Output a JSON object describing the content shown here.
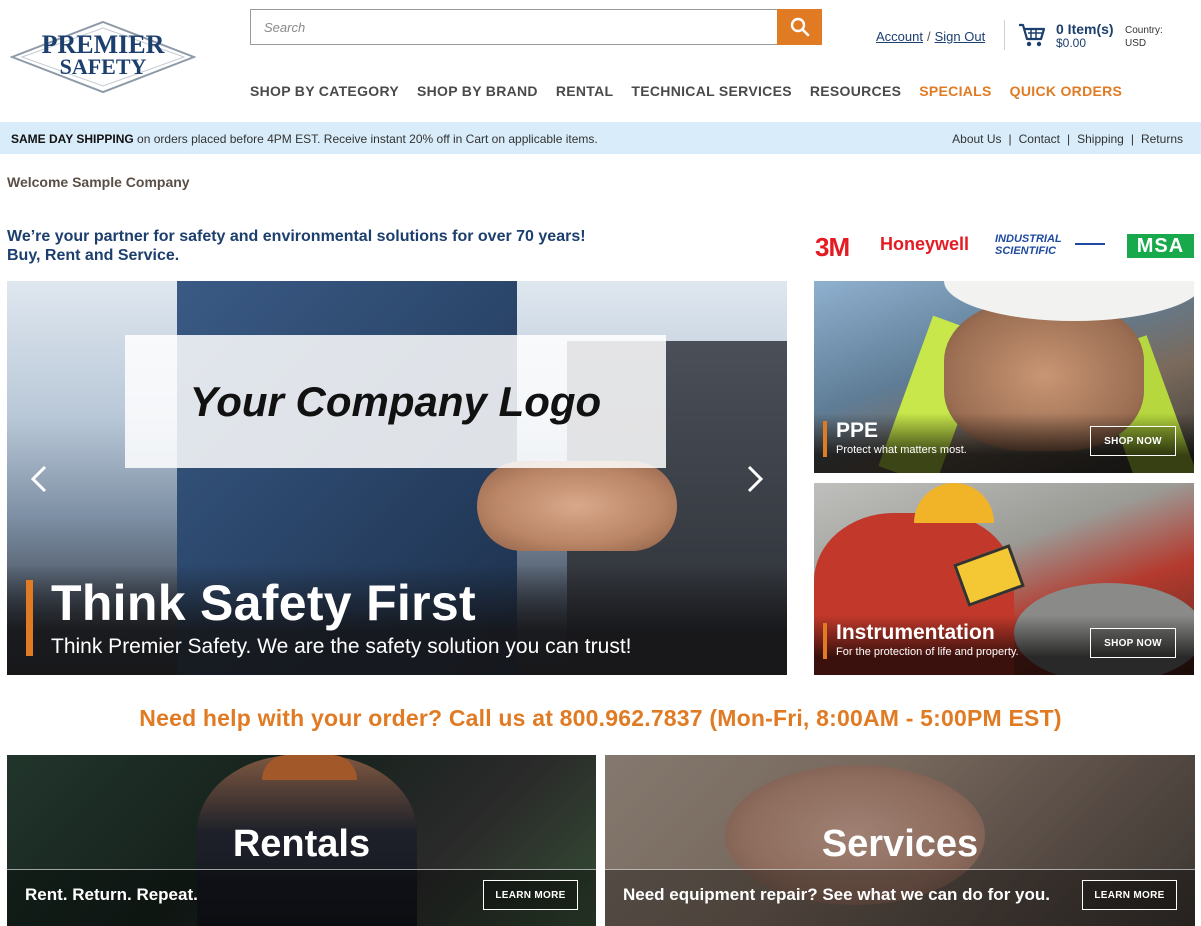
{
  "header": {
    "logo_line1": "PREMIER",
    "logo_line2": "SAFETY",
    "search_placeholder": "Search",
    "account_link": "Account",
    "account_sep": "/",
    "signout_link": "Sign Out",
    "cart_count": "0 Item(s)",
    "cart_total": "$0.00",
    "country_label": "Country:",
    "country_value": "USD"
  },
  "nav": {
    "items": [
      {
        "label": "SHOP BY CATEGORY"
      },
      {
        "label": "SHOP BY BRAND"
      },
      {
        "label": "RENTAL"
      },
      {
        "label": "TECHNICAL SERVICES"
      },
      {
        "label": "RESOURCES"
      },
      {
        "label": "SPECIALS"
      },
      {
        "label": "QUICK ORDERS"
      }
    ]
  },
  "promo_bar": {
    "bold_text": "SAME DAY SHIPPING",
    "text": " on orders placed before 4PM EST. Receive instant 20% off in Cart on applicable items.",
    "links": [
      {
        "label": "About Us"
      },
      {
        "label": "Contact"
      },
      {
        "label": "Shipping"
      },
      {
        "label": "Returns"
      }
    ],
    "sep": "|"
  },
  "welcome": "Welcome Sample Company",
  "tagline": {
    "line1": "We’re your partner for safety and environmental solutions for over 70 years!",
    "line2": "Buy, Rent and Service."
  },
  "brands": {
    "b1": "3M",
    "b2": "Honeywell",
    "b3_line1": "INDUSTRIAL",
    "b3_line2": "SCIENTIFIC",
    "b4": "MSA"
  },
  "hero": {
    "logo_text": "Your Company Logo",
    "title": "Think Safety First",
    "subtitle": "Think Premier Safety. We are the safety solution you can trust!"
  },
  "side_promos": [
    {
      "title": "PPE",
      "subtitle": "Protect what matters most.",
      "button": "SHOP NOW"
    },
    {
      "title": "Instrumentation",
      "subtitle": "For the protection of life and property.",
      "button": "SHOP NOW"
    }
  ],
  "help_text": "Need help with your order? Call us at 800.962.7837 (Mon-Fri, 8:00AM - 5:00PM EST)",
  "bottom_cards": [
    {
      "title": "Rentals",
      "text": "Rent. Return. Repeat.",
      "button": "LEARN MORE"
    },
    {
      "title": "Services",
      "text": "Need equipment repair? See what we can do for you.",
      "button": "LEARN MORE"
    }
  ],
  "colors": {
    "accent_orange": "#e07b24",
    "navy": "#1c3f6e",
    "promo_bar_bg": "#d8ecf9"
  }
}
